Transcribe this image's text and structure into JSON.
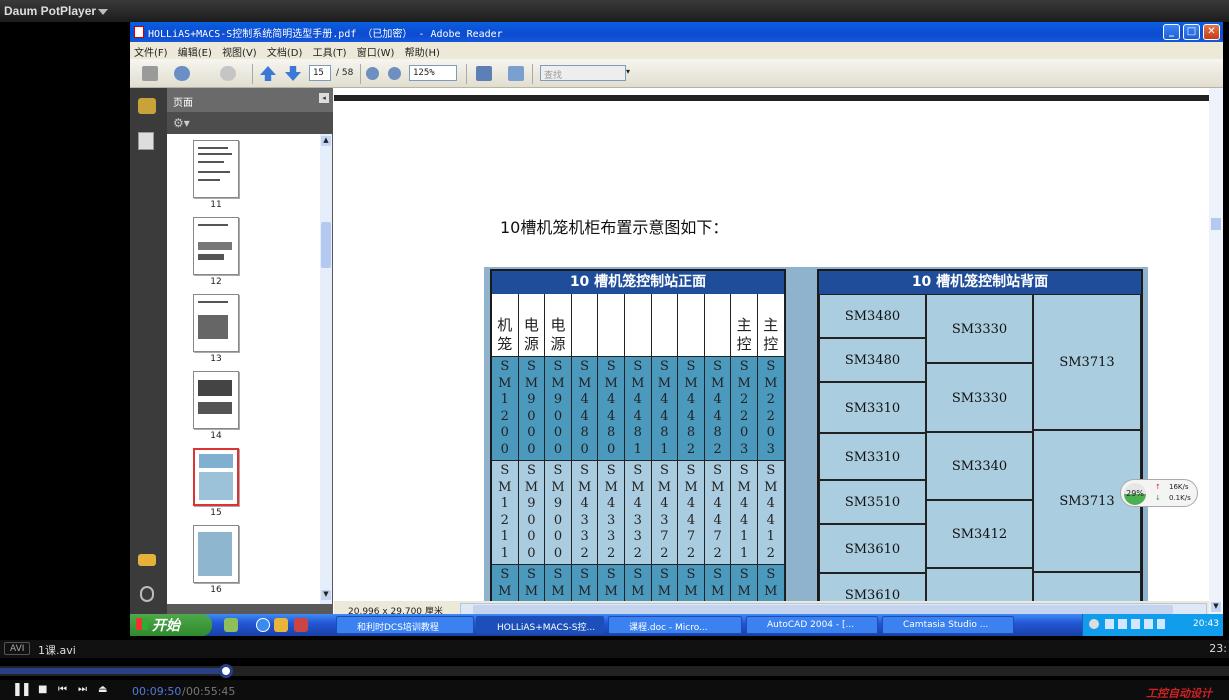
{
  "player": {
    "brand": "Daum PotPlayer",
    "format": "AVI",
    "filename": "1课.avi",
    "time_right": "23:",
    "elapsed": "00:09:50",
    "separator": "/",
    "total": "00:55:45",
    "progress_fraction": 0.176,
    "watermark": "工控自动设计"
  },
  "window": {
    "title": "HOLLiAS+MACS-S控制系统简明选型手册.pdf （已加密） - Adobe Reader"
  },
  "menu": [
    "文件(F)",
    "编辑(E)",
    "视图(V)",
    "文档(D)",
    "工具(T)",
    "窗口(W)",
    "帮助(H)"
  ],
  "toolbar": {
    "page_current": "15",
    "page_total": "/ 58",
    "zoom": "125%",
    "search_placeholder": "查找"
  },
  "nav": {
    "header": "页面",
    "thumbnails": [
      {
        "num": "11"
      },
      {
        "num": "12"
      },
      {
        "num": "13"
      },
      {
        "num": "14"
      },
      {
        "num": "15"
      },
      {
        "num": "16"
      }
    ]
  },
  "document": {
    "heading": "10槽机笼机柜布置示意图如下：",
    "status_size": "20.996 x 29.700 厘米",
    "front": {
      "title": "10 槽机笼控制站正面",
      "columns": [
        {
          "head": "机笼",
          "r1": "SM1200",
          "r2": "SM1211"
        },
        {
          "head": "电源",
          "r1": "SM9000",
          "r2": "SM9000"
        },
        {
          "head": "电源",
          "r1": "SM9000",
          "r2": "SM9000"
        },
        {
          "head": "",
          "r1": "SM4480",
          "r2": "SM4332"
        },
        {
          "head": "",
          "r1": "SM4480",
          "r2": "SM4332"
        },
        {
          "head": "",
          "r1": "SM4481",
          "r2": "SM4332"
        },
        {
          "head": "",
          "r1": "SM4481",
          "r2": "SM4372"
        },
        {
          "head": "",
          "r1": "SM4482",
          "r2": "SM4472"
        },
        {
          "head": "",
          "r1": "SM4482",
          "r2": "SM4472"
        },
        {
          "head": "主控",
          "r1": "SM2203",
          "r2": "SM4411"
        },
        {
          "head": "主控",
          "r1": "SM2203",
          "r2": "SM4412"
        }
      ],
      "r3_letters": "SM"
    },
    "back": {
      "title": "10 槽机笼控制站背面",
      "col1": [
        "SM3480",
        "SM3480",
        "SM3310",
        "SM3310",
        "SM3510",
        "SM3610",
        "SM3610"
      ],
      "col2": [
        "SM3330",
        "SM3330",
        "SM3340",
        "SM3412"
      ],
      "col3": [
        "SM3713",
        "SM3713"
      ]
    }
  },
  "net_widget": {
    "percent": "29%",
    "up": "16K/s",
    "down": "0.1K/s"
  },
  "taskbar": {
    "start": "开始",
    "tasks": [
      "和利时DCS培训教程",
      "HOLLiAS+MACS-S控...",
      "课程.doc - Micro...",
      "AutoCAD 2004 - [...",
      "Camtasia Studio ..."
    ],
    "clock": "20:43"
  }
}
